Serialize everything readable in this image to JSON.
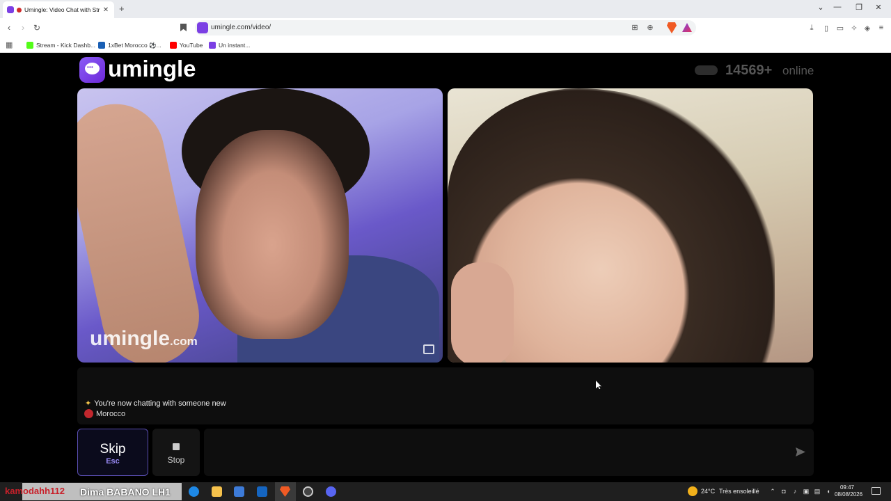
{
  "browser": {
    "tab_title": "Umingle: Video Chat with Str",
    "tab_close": "✕",
    "new_tab": "+",
    "url": "umingle.com/video/",
    "bookmarks": [
      {
        "label": "Stream - Kick Dashb...",
        "color": "#53fc18"
      },
      {
        "label": "1xBet Morocco ⚽...",
        "color": "#1a5fb4"
      },
      {
        "label": "YouTube",
        "color": "#ff0000"
      },
      {
        "label": "Un instant...",
        "color": "#7b3fe4"
      }
    ]
  },
  "site": {
    "logo_text": "umingle",
    "online_count": "14569+",
    "online_label": "online",
    "brand_color": "#7b3fe4"
  },
  "video": {
    "watermark": "umingle",
    "watermark_suffix": ".com"
  },
  "chat": {
    "system_message": "You're now chatting with someone new",
    "country": "Morocco"
  },
  "controls": {
    "skip_label": "Skip",
    "skip_key": "Esc",
    "stop_label": "Stop",
    "message_placeholder": ""
  },
  "taskbar": {
    "overlay_text": "kamodahh112",
    "stream_label": "Dima BABANO LH1",
    "temperature": "24°C",
    "weather": "Très ensoleillé",
    "time": "09:47",
    "date": "08/08/2026"
  }
}
